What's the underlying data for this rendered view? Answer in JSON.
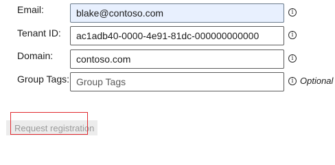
{
  "form": {
    "email": {
      "label": "Email:",
      "value": "blake@contoso.com"
    },
    "tenant_id": {
      "label": "Tenant ID:",
      "value": "ac1adb40-0000-4e91-81dc-000000000000"
    },
    "domain": {
      "label": "Domain:",
      "value": "contoso.com"
    },
    "group_tags": {
      "label": "Group Tags:",
      "placeholder": "Group Tags",
      "optional_text": "Optional"
    },
    "info_icon_glyph": "i"
  },
  "actions": {
    "request_registration_label": "Request registration"
  },
  "colors": {
    "highlight_field": "#e8f0fe",
    "focus_outline": "#e0282e",
    "disabled_text": "#9a9a9a"
  }
}
